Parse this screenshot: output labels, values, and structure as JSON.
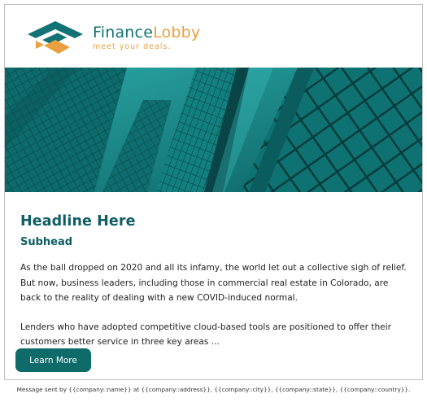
{
  "brand": {
    "name_part1": "Finance",
    "name_part2": "Lobby",
    "tagline": "meet your deals."
  },
  "colors": {
    "primary_teal": "#127275",
    "accent_orange": "#e8a040",
    "heading_teal": "#0f5e63",
    "button_teal": "#0f6a6a"
  },
  "hero": {
    "icon": "city-skyscrapers-image"
  },
  "content": {
    "headline": "Headline Here",
    "subhead": "Subhead",
    "paragraph_1": "As the ball dropped on 2020 and all its infamy, the world let out a collective sigh of relief. But now, business leaders, including those in commercial real estate in Colorado, are back to the reality of dealing with a new COVID-induced normal.",
    "paragraph_2": "Lenders who have adopted competitive cloud-based tools are positioned to offer their customers better service in three key areas ..."
  },
  "cta": {
    "label": "Learn More"
  },
  "footer": {
    "text": "Message sent by {{company::name}} at {{company::address}}, {{company::city}}, {{company::state}}, {{company::country}}."
  }
}
